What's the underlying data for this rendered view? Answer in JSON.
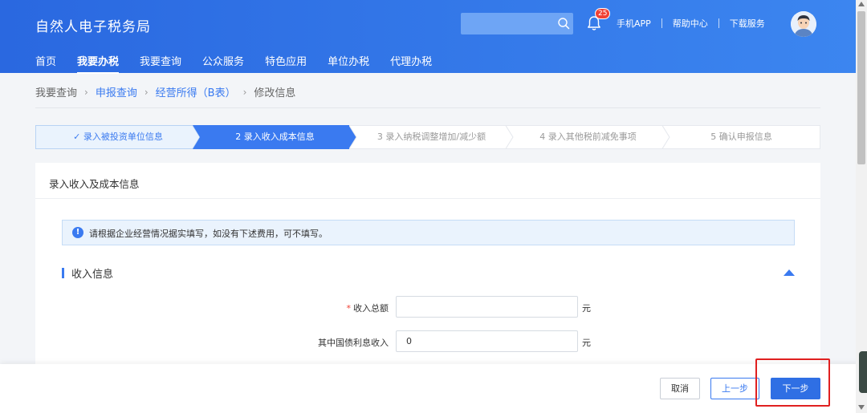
{
  "header": {
    "logo": "自然人电子税务局",
    "search": {
      "placeholder": ""
    },
    "notification_count": "25",
    "links": [
      "手机APP",
      "帮助中心",
      "下载服务"
    ]
  },
  "nav": {
    "items": [
      {
        "label": "首页",
        "active": false
      },
      {
        "label": "我要办税",
        "active": true
      },
      {
        "label": "我要查询",
        "active": false
      },
      {
        "label": "公众服务",
        "active": false
      },
      {
        "label": "特色应用",
        "active": false
      },
      {
        "label": "单位办税",
        "active": false
      },
      {
        "label": "代理办税",
        "active": false
      }
    ]
  },
  "breadcrumb": {
    "items": [
      "我要查询",
      "申报查询",
      "经营所得（B表）",
      "修改信息"
    ],
    "separator": "›"
  },
  "steps": [
    {
      "label": "✓ 录入被投资单位信息",
      "state": "done"
    },
    {
      "label": "2  录入收入成本信息",
      "state": "active"
    },
    {
      "label": "3  录入纳税调整增加/减少额",
      "state": "todo"
    },
    {
      "label": "4  录入其他税前减免事项",
      "state": "todo"
    },
    {
      "label": "5  确认申报信息",
      "state": "todo"
    }
  ],
  "panel": {
    "title": "录入收入及成本信息",
    "notice": "请根据企业经营情况据实填写，如没有下述费用，可不填写。",
    "notice_icon": "info-icon",
    "section_title": "收入信息",
    "fields": [
      {
        "label": "收入总额",
        "required": true,
        "value": "",
        "unit": "元"
      },
      {
        "label": "其中国债利息收入",
        "required": false,
        "value": "0",
        "unit": "元"
      }
    ]
  },
  "footer": {
    "cancel_label": "取消",
    "prev_label": "上一步",
    "next_label": "下一步"
  },
  "colors": {
    "primary": "#3a7af0",
    "header_start": "#2a68e0",
    "header_end": "#3c86f0",
    "highlight": "#e02020",
    "badge": "#f04134"
  }
}
